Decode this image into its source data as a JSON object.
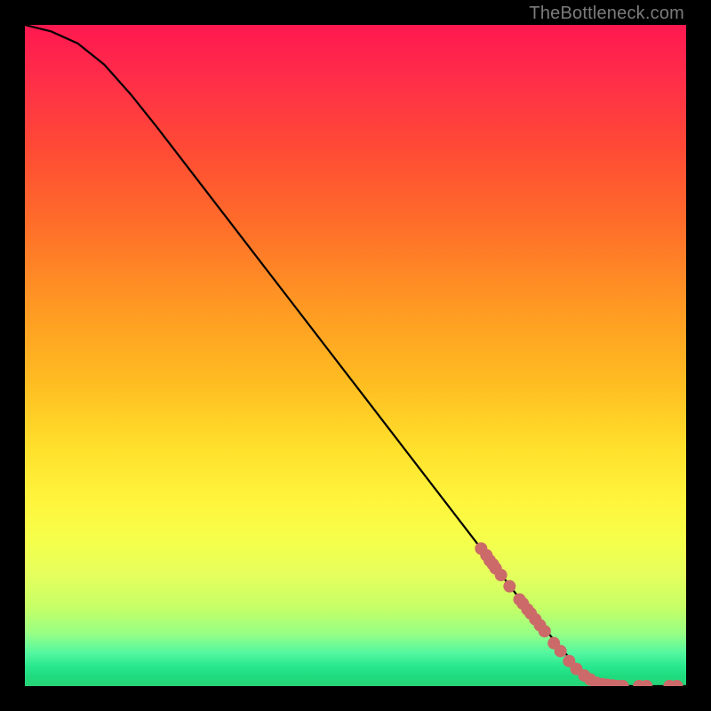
{
  "watermark": "TheBottleneck.com",
  "chart_data": {
    "type": "line",
    "title": "",
    "xlabel": "",
    "ylabel": "",
    "xlim": [
      0,
      1
    ],
    "ylim": [
      0,
      1
    ],
    "curve": {
      "name": "bottleneck-curve",
      "color": "#000000",
      "points": [
        {
          "x": 0.0,
          "y": 1.0
        },
        {
          "x": 0.04,
          "y": 0.99
        },
        {
          "x": 0.08,
          "y": 0.972
        },
        {
          "x": 0.12,
          "y": 0.94
        },
        {
          "x": 0.16,
          "y": 0.895
        },
        {
          "x": 0.2,
          "y": 0.845
        },
        {
          "x": 0.25,
          "y": 0.78
        },
        {
          "x": 0.3,
          "y": 0.715
        },
        {
          "x": 0.35,
          "y": 0.65
        },
        {
          "x": 0.4,
          "y": 0.585
        },
        {
          "x": 0.45,
          "y": 0.52
        },
        {
          "x": 0.5,
          "y": 0.455
        },
        {
          "x": 0.55,
          "y": 0.39
        },
        {
          "x": 0.6,
          "y": 0.325
        },
        {
          "x": 0.65,
          "y": 0.26
        },
        {
          "x": 0.7,
          "y": 0.195
        },
        {
          "x": 0.75,
          "y": 0.13
        },
        {
          "x": 0.8,
          "y": 0.07
        },
        {
          "x": 0.83,
          "y": 0.035
        },
        {
          "x": 0.855,
          "y": 0.012
        },
        {
          "x": 0.87,
          "y": 0.004
        },
        {
          "x": 0.89,
          "y": 0.001
        },
        {
          "x": 0.92,
          "y": 0.0
        },
        {
          "x": 1.0,
          "y": 0.0
        }
      ]
    },
    "markers": {
      "name": "highlighted-segment",
      "color": "#cb6a68",
      "radius": 7,
      "points": [
        {
          "x": 0.69,
          "y": 0.208
        },
        {
          "x": 0.698,
          "y": 0.198
        },
        {
          "x": 0.703,
          "y": 0.19
        },
        {
          "x": 0.708,
          "y": 0.184
        },
        {
          "x": 0.712,
          "y": 0.178
        },
        {
          "x": 0.72,
          "y": 0.168
        },
        {
          "x": 0.733,
          "y": 0.151
        },
        {
          "x": 0.748,
          "y": 0.131
        },
        {
          "x": 0.753,
          "y": 0.125
        },
        {
          "x": 0.76,
          "y": 0.116
        },
        {
          "x": 0.765,
          "y": 0.11
        },
        {
          "x": 0.772,
          "y": 0.101
        },
        {
          "x": 0.779,
          "y": 0.092
        },
        {
          "x": 0.786,
          "y": 0.083
        },
        {
          "x": 0.8,
          "y": 0.065
        },
        {
          "x": 0.81,
          "y": 0.053
        },
        {
          "x": 0.823,
          "y": 0.038
        },
        {
          "x": 0.834,
          "y": 0.026
        },
        {
          "x": 0.846,
          "y": 0.016
        },
        {
          "x": 0.855,
          "y": 0.01
        },
        {
          "x": 0.864,
          "y": 0.005
        },
        {
          "x": 0.873,
          "y": 0.003
        },
        {
          "x": 0.881,
          "y": 0.002
        },
        {
          "x": 0.889,
          "y": 0.001
        },
        {
          "x": 0.897,
          "y": 0.0
        },
        {
          "x": 0.904,
          "y": 0.0
        },
        {
          "x": 0.929,
          "y": 0.0
        },
        {
          "x": 0.94,
          "y": 0.0
        },
        {
          "x": 0.975,
          "y": 0.0
        },
        {
          "x": 0.986,
          "y": 0.0
        }
      ]
    }
  }
}
